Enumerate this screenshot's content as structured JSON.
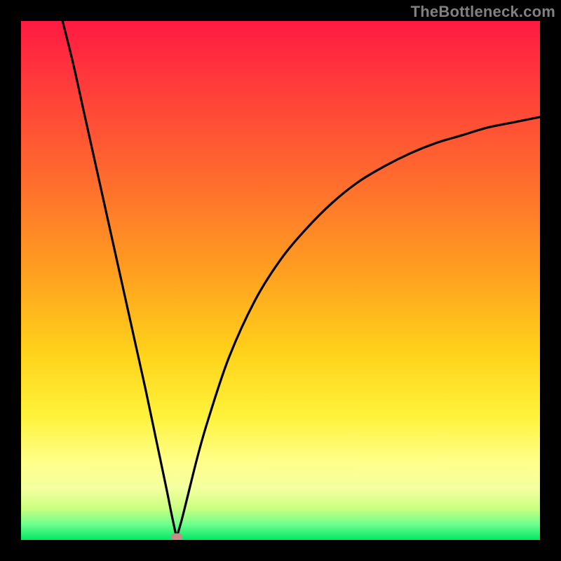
{
  "watermark": "TheBottleneck.com",
  "chart_data": {
    "type": "line",
    "title": "",
    "xlabel": "",
    "ylabel": "",
    "xlim": [
      0,
      100
    ],
    "ylim": [
      0,
      100
    ],
    "x": [
      8,
      10,
      12,
      14,
      16,
      18,
      20,
      22,
      24,
      26,
      28,
      29,
      29.8,
      30,
      30.2,
      31,
      32,
      34,
      36,
      40,
      45,
      50,
      55,
      60,
      65,
      70,
      75,
      80,
      85,
      90,
      95,
      100
    ],
    "y": [
      100,
      92,
      83,
      74,
      65,
      56,
      47,
      38,
      29,
      19.5,
      10,
      5,
      1.2,
      0.5,
      1.2,
      4,
      8,
      16,
      23,
      35,
      46,
      54,
      60,
      65,
      69,
      72,
      74.5,
      76.5,
      78,
      79.5,
      80.5,
      81.5
    ],
    "minimum": {
      "x": 30,
      "y": 0.5
    },
    "gradient_scale": {
      "top_color": "#ff1a42",
      "mid_color": "#ffd21a",
      "bottom_color": "#00e763",
      "meaning": "value from high (red) to low (green)"
    },
    "marker": {
      "x": 30,
      "y": 0.6,
      "shape": "rounded-rect",
      "color": "#c98a8a"
    }
  }
}
